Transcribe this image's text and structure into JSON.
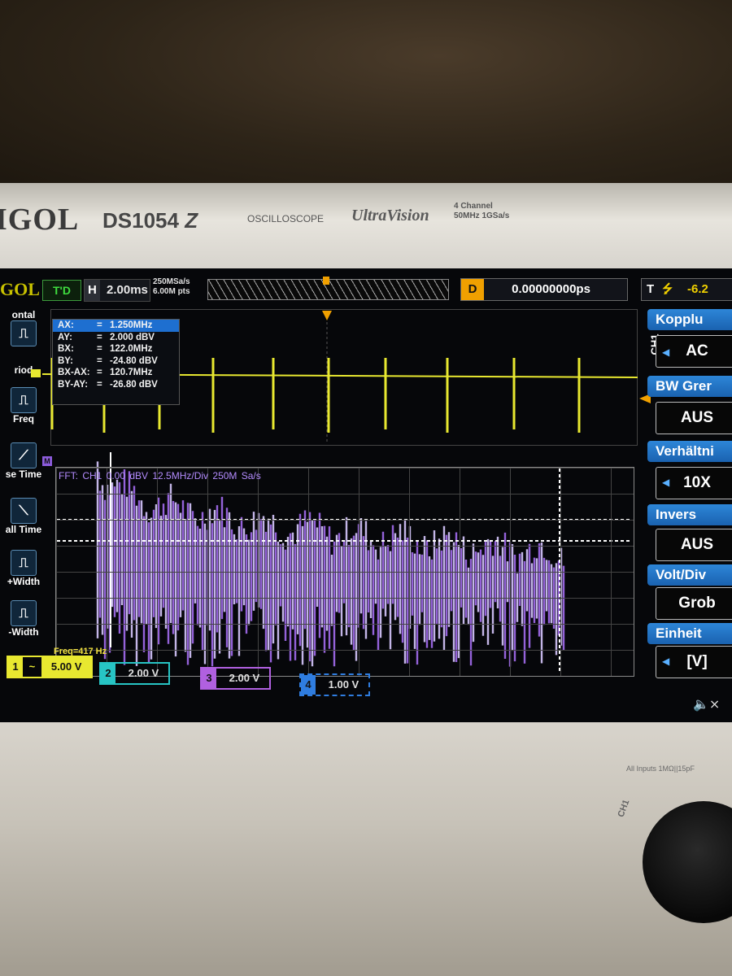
{
  "instrument": {
    "brand": "IGOL",
    "model": "DS1054",
    "model_suffix": "Z",
    "type_label": "OSCILLOSCOPE",
    "series": "UltraVision",
    "spec_line1": "4 Channel",
    "spec_line2": "50MHz  1GSa/s",
    "inputs_label": "All Inputs 1MΩ||15pF",
    "lower_ch_label": "CH1"
  },
  "topbar": {
    "logo": "GOL",
    "trigger_state": "T'D",
    "h_label": "H",
    "timebase": "2.00ms",
    "sample_rate": "250MSa/s",
    "memory_depth": "6.00M pts",
    "delay_label": "D",
    "delay_value": "0.00000000ps",
    "trigger_label": "T",
    "trigger_value": "-6.2"
  },
  "left_menu": {
    "items": [
      {
        "label": "ontal",
        "icon": "⎍"
      },
      {
        "label": "riod",
        "icon": "⎍"
      },
      {
        "label": "Freq",
        "icon": "⎍"
      },
      {
        "label": "se Time",
        "icon": "⟋"
      },
      {
        "label": "all Time",
        "icon": "⟍"
      },
      {
        "label": "+Width",
        "icon": "⎍"
      },
      {
        "label": "-Width",
        "icon": "⎍"
      }
    ]
  },
  "cursor": {
    "rows": [
      {
        "label": "AX:",
        "value": "1.250MHz",
        "selected": true
      },
      {
        "label": "AY:",
        "value": "2.000 dBV"
      },
      {
        "label": "BX:",
        "value": "122.0MHz"
      },
      {
        "label": "BY:",
        "value": "-24.80 dBV"
      },
      {
        "label": "BX-AX:",
        "value": "120.7MHz"
      },
      {
        "label": "BY-AY:",
        "value": "-26.80 dBV"
      }
    ]
  },
  "fft": {
    "marker": "M",
    "label": "FFT: CH1  0.00 dBV  12.5MHz/Div  250M Sa/s",
    "freq_readout": "Freq=417 Hz"
  },
  "channels": [
    {
      "num": "1",
      "coupling": "~",
      "scale": "5.00 V",
      "color": "#e8e830"
    },
    {
      "num": "2",
      "scale": "2.00 V",
      "color": "#27c4c4"
    },
    {
      "num": "3",
      "scale": "2.00 V",
      "color": "#b060e0"
    },
    {
      "num": "4",
      "scale": "1.00 V",
      "color": "#2f7de0"
    }
  ],
  "right_menu": {
    "channel_tag": "CH1",
    "items": [
      {
        "title": "Kopplu",
        "value": "AC",
        "has_arrow": true
      },
      {
        "title": "BW Grer",
        "value": "AUS",
        "has_arrow": false
      },
      {
        "title": "Verhältni",
        "value": "10X",
        "has_arrow": true
      },
      {
        "title": "Invers",
        "value": "AUS",
        "has_arrow": false
      },
      {
        "title": "Volt/Div",
        "value": "Grob",
        "has_arrow": false
      },
      {
        "title": "Einheit",
        "value": "[V]",
        "has_arrow": true
      }
    ]
  },
  "colors": {
    "ch1_trace": "#e8e830",
    "fft_trace": "#a46cf0",
    "cursor_line": "#ffffff",
    "menu_blue": "#1e6fd0"
  },
  "icons": {
    "speaker": "🔈×"
  }
}
